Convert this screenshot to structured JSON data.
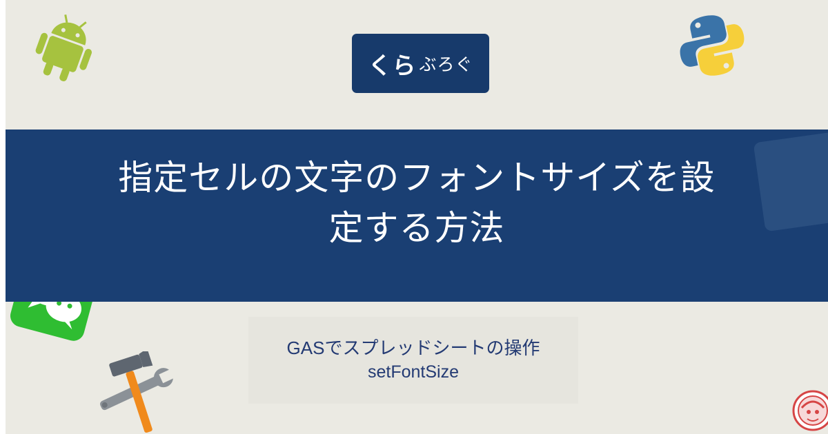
{
  "logo": {
    "part1": "くら",
    "part2": "ぶろぐ"
  },
  "title": {
    "line1": "指定セルの文字のフォントサイズを設",
    "line2": "定する方法"
  },
  "subtitle": {
    "line1": "GASでスプレッドシートの操作",
    "line2": "setFontSize"
  },
  "icons": [
    "android-icon",
    "python-icon",
    "wechat-icon",
    "tools-icon",
    "avatar-icon"
  ],
  "colors": {
    "band": "#1a3f73",
    "background": "#ebeae3",
    "logo_bg": "#173a6b",
    "subtitle_text": "#233a73"
  }
}
